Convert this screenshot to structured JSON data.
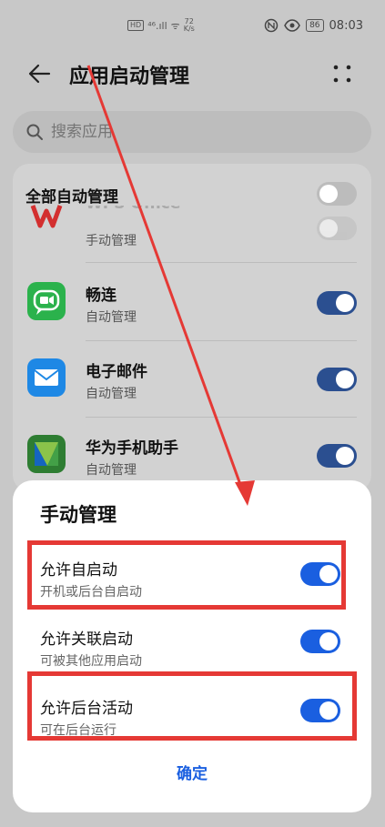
{
  "status_bar": {
    "hd": "HD",
    "signal": "⁴⁶.ıll",
    "wifi": "ᯤ",
    "speed_value": "72",
    "speed_unit": "K/s",
    "icons": [
      "nfc-icon",
      "eye-icon"
    ],
    "battery": "86",
    "time": "08:03"
  },
  "header": {
    "title": "应用启动管理"
  },
  "search": {
    "placeholder": "搜索应用"
  },
  "list": {
    "all_label": "全部自动管理",
    "all_toggle": "off",
    "apps": [
      {
        "name": "WPS Office",
        "status": "手动管理",
        "toggle": "off",
        "icon": "wps-icon",
        "icon_color": "#d32f2f"
      },
      {
        "name": "畅连",
        "status": "自动管理",
        "toggle": "on",
        "icon": "changlian-icon",
        "icon_color": "#2bb24c"
      },
      {
        "name": "电子邮件",
        "status": "自动管理",
        "toggle": "on",
        "icon": "email-icon",
        "icon_color": "#1e88e5"
      },
      {
        "name": "华为手机助手",
        "status": "自动管理",
        "toggle": "on",
        "icon": "hisuite-icon",
        "icon_color": "#2e7d32"
      }
    ]
  },
  "sheet": {
    "title": "手动管理",
    "options": [
      {
        "label": "允许自启动",
        "desc": "开机或后台自启动",
        "toggle": "on",
        "highlighted": true
      },
      {
        "label": "允许关联启动",
        "desc": "可被其他应用启动",
        "toggle": "on",
        "highlighted": false
      },
      {
        "label": "允许后台活动",
        "desc": "可在后台运行",
        "toggle": "on",
        "highlighted": true
      }
    ],
    "confirm": "确定"
  },
  "colors": {
    "accent": "#1a5fe0",
    "annotation": "#e53935"
  }
}
